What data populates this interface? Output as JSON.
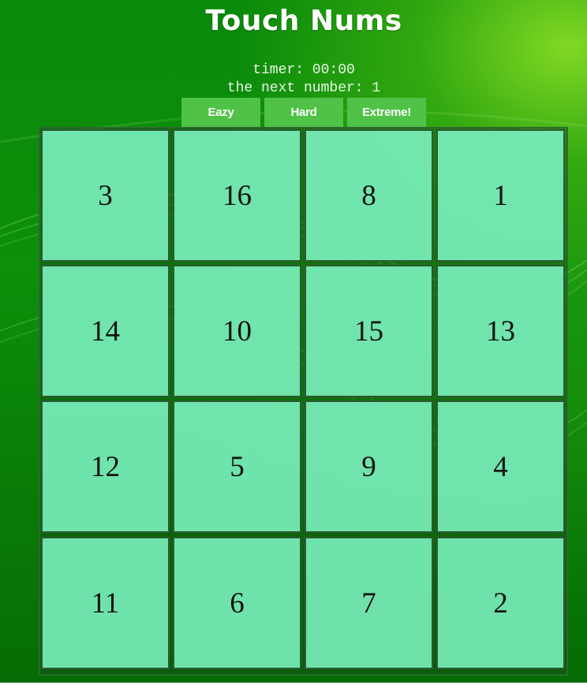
{
  "header": {
    "title": "Touch Nums"
  },
  "status": {
    "timer": "timer: 00:00",
    "next_number": "the next number: 1"
  },
  "levels": {
    "eazy": "Eazy",
    "hard": "Hard",
    "extreme": "Extreme!"
  },
  "board": {
    "rows": 4,
    "cols": 4,
    "cells": [
      "3",
      "16",
      "8",
      "1",
      "14",
      "10",
      "15",
      "13",
      "12",
      "5",
      "9",
      "4",
      "11",
      "6",
      "7",
      "2"
    ]
  },
  "colors": {
    "background": "#0d8f0a",
    "button": "#4fc247",
    "cell": "#7df5c3",
    "cell_border": "#2c5a32"
  }
}
